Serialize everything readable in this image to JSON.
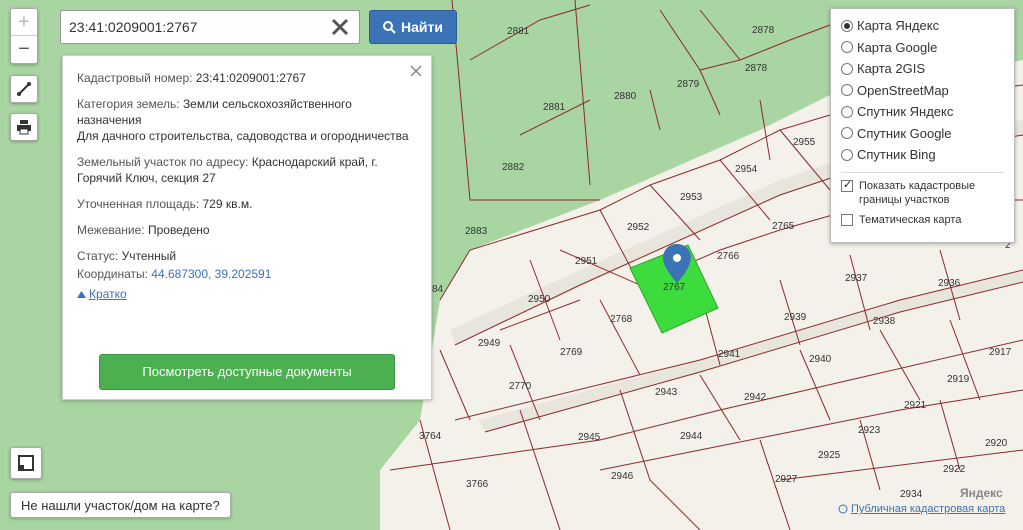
{
  "search": {
    "value": "23:41:0209001:2767",
    "find_label": "Найти"
  },
  "zoom": {
    "plus": "+",
    "minus": "−"
  },
  "info": {
    "cadastral_label": "Кадастровый номер:",
    "cadastral_value": "23:41:0209001:2767",
    "category_label": "Категория земель:",
    "category_value": "Земли сельскохозяйственного назначения",
    "usage_value": "Для дачного строительства, садоводства и огородничества",
    "address_label": "Земельный участок по адресу:",
    "address_value": "Краснодарский край, г. Горячий Ключ, секция 27",
    "area_label": "Уточненная площадь:",
    "area_value": "729 кв.м.",
    "survey_label": "Межевание:",
    "survey_value": "Проведено",
    "status_label": "Статус:",
    "status_value": "Учтенный",
    "coords_label": "Координаты:",
    "coords_value": "44.687300, 39.202591",
    "brief_link": "Кратко",
    "docs_button": "Посмотреть доступные документы"
  },
  "layers": {
    "options": [
      {
        "label": "Карта Яндекс",
        "selected": true
      },
      {
        "label": "Карта Google",
        "selected": false
      },
      {
        "label": "Карта 2GIS",
        "selected": false
      },
      {
        "label": "OpenStreetMap",
        "selected": false
      },
      {
        "label": "Спутник Яндекс",
        "selected": false
      },
      {
        "label": "Спутник Google",
        "selected": false
      },
      {
        "label": "Спутник Bing",
        "selected": false
      }
    ],
    "show_borders": "Показать кадастровые границы участков",
    "thematic": "Тематическая карта"
  },
  "not_found": "Не нашли участок/дом на карте?",
  "attribution": "Публичная кадастровая карта",
  "watermark": "Яндекс",
  "map": {
    "colors": {
      "forest": "#a8d5a2",
      "field": "#f3f1e9",
      "road": "#e8e5dc",
      "border": "#8b2a2a",
      "selected": "#3ddc3d",
      "pin": "#3b73b5"
    },
    "plots": [
      "2881",
      "2878",
      "2879",
      "2880",
      "2881",
      "2882",
      "2883",
      "2955",
      "2954",
      "2953",
      "2952",
      "2765",
      "2766",
      "2767",
      "2951",
      "2950",
      "2768",
      "2949",
      "2769",
      "2770",
      "2937",
      "2936",
      "2939",
      "2938",
      "2940",
      "2941",
      "2943",
      "2942",
      "2944",
      "2945",
      "2946",
      "3764",
      "3766",
      "2921",
      "2919",
      "2917",
      "2923",
      "2920",
      "2922",
      "2925",
      "2927",
      "2934",
      "84"
    ]
  }
}
